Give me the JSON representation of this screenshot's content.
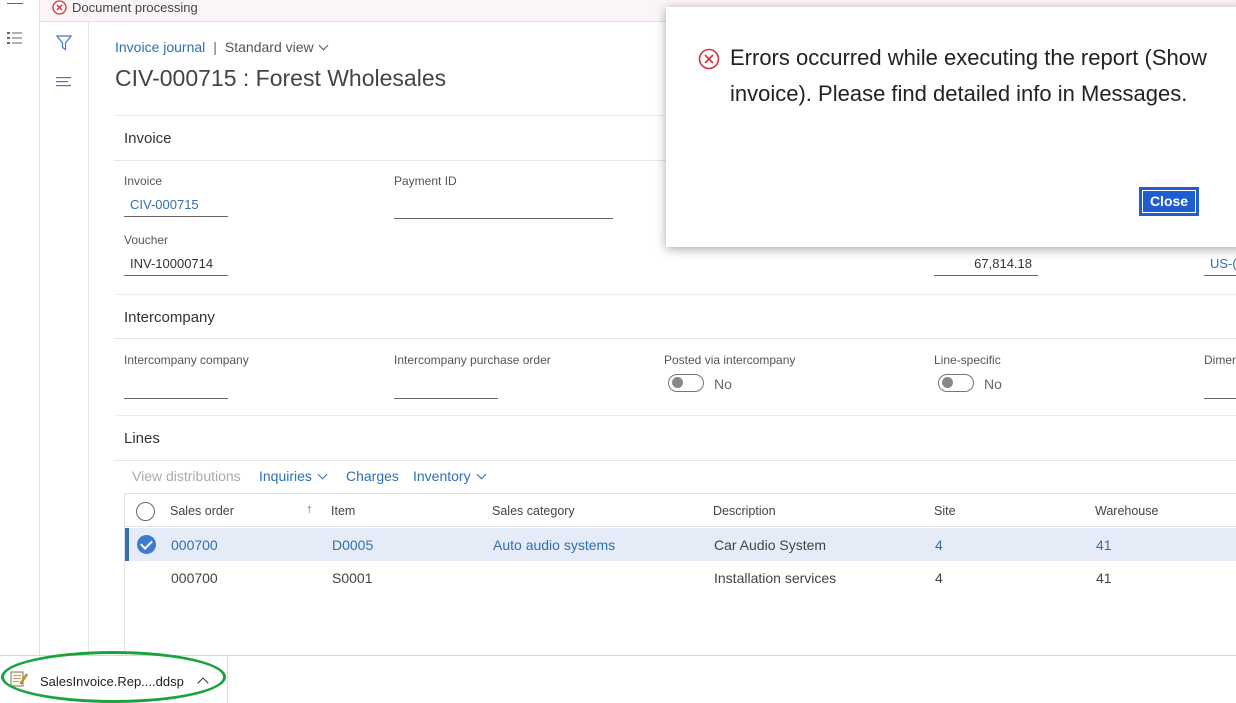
{
  "banner": {
    "label": "Document processing"
  },
  "header": {
    "breadcrumb_link": "Invoice journal",
    "separator": "|",
    "view": "Standard view",
    "title": "CIV-000715 : Forest Wholesales"
  },
  "invoice": {
    "heading": "Invoice",
    "invoice_label": "Invoice",
    "invoice_value": "CIV-000715",
    "payment_id_label": "Payment ID",
    "voucher_label": "Voucher",
    "voucher_value": "INV-10000714",
    "amount_value": "67,814.18",
    "partial_link": "US-("
  },
  "intercompany": {
    "heading": "Intercompany",
    "company_label": "Intercompany company",
    "po_label": "Intercompany purchase order",
    "posted_label": "Posted via intercompany",
    "posted_value": "No",
    "line_specific_label": "Line-specific",
    "line_specific_value": "No",
    "dimen_label": "Dimer"
  },
  "lines": {
    "heading": "Lines",
    "tools": {
      "view_distributions": "View distributions",
      "inquiries": "Inquiries",
      "charges": "Charges",
      "inventory": "Inventory"
    },
    "columns": {
      "sales_order": "Sales order",
      "sort_arrow": "↑",
      "item": "Item",
      "sales_category": "Sales category",
      "description": "Description",
      "site": "Site",
      "warehouse": "Warehouse"
    },
    "rows": [
      {
        "sales_order": "000700",
        "item": "D0005",
        "sales_category": "Auto audio systems",
        "description": "Car Audio System",
        "site": "4",
        "warehouse": "41"
      },
      {
        "sales_order": "000700",
        "item": "S0001",
        "sales_category": "",
        "description": "Installation services",
        "site": "4",
        "warehouse": "41"
      }
    ]
  },
  "dialog": {
    "message": "Errors occurred while executing the report (Show invoice). Please find detailed info in Messages.",
    "close_label": "Close"
  },
  "download": {
    "filename": "SalesInvoice.Rep....ddsp"
  },
  "colors": {
    "accent": "#2f6fb4",
    "error": "#d13438",
    "highlight_ellipse": "#1aa33d",
    "button": "#1f5ed1"
  }
}
